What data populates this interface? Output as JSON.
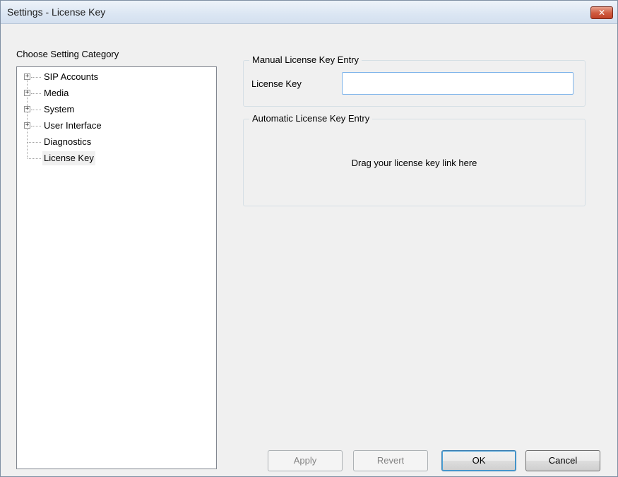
{
  "window": {
    "title": "Settings - License Key",
    "close_glyph": "✕"
  },
  "sidebar": {
    "heading": "Choose Setting Category",
    "items": [
      {
        "label": "SIP Accounts",
        "expandable": true
      },
      {
        "label": "Media",
        "expandable": true
      },
      {
        "label": "System",
        "expandable": true
      },
      {
        "label": "User Interface",
        "expandable": true
      },
      {
        "label": "Diagnostics",
        "expandable": false
      },
      {
        "label": "License Key",
        "expandable": false,
        "selected": true
      }
    ],
    "expander_glyph": "+"
  },
  "manual": {
    "legend": "Manual License Key Entry",
    "field_label": "License Key",
    "field_value": ""
  },
  "automatic": {
    "legend": "Automatic License Key Entry",
    "drop_text": "Drag your license key link here"
  },
  "buttons": {
    "apply": "Apply",
    "revert": "Revert",
    "ok": "OK",
    "cancel": "Cancel"
  },
  "colors": {
    "close_button": "#c2432a",
    "input_focus_border": "#7eb4ea"
  }
}
